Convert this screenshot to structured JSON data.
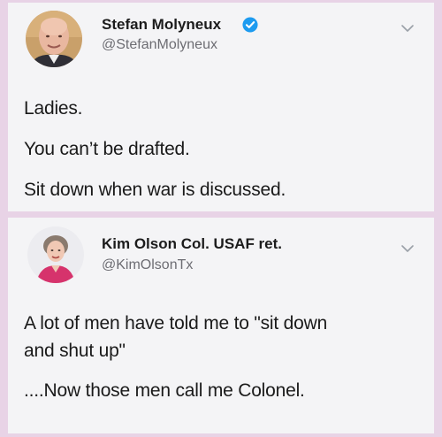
{
  "tweets": [
    {
      "name": "Stefan Molyneux",
      "handle": "@StefanMolyneux",
      "verified": true,
      "avatar_icon": "bald-man-avatar-icon",
      "chevron_icon": "chevron-down-icon",
      "lines": [
        "Ladies.",
        "You can’t be drafted.",
        "Sit down when war is discussed."
      ]
    },
    {
      "name": "Kim Olson Col. USAF ret.",
      "handle": "@KimOlsonTx",
      "verified": false,
      "avatar_icon": "woman-avatar-icon",
      "chevron_icon": "chevron-down-icon",
      "lines": [
        "A lot of men have told me to \"sit down",
        "and shut up\"",
        "....Now those men call me Colonel."
      ]
    }
  ],
  "colors": {
    "page_background": "#e8d3e6",
    "card_background": "#f4f4f6",
    "verified_blue": "#1d9bf0",
    "handle_gray": "#6d6d73"
  }
}
